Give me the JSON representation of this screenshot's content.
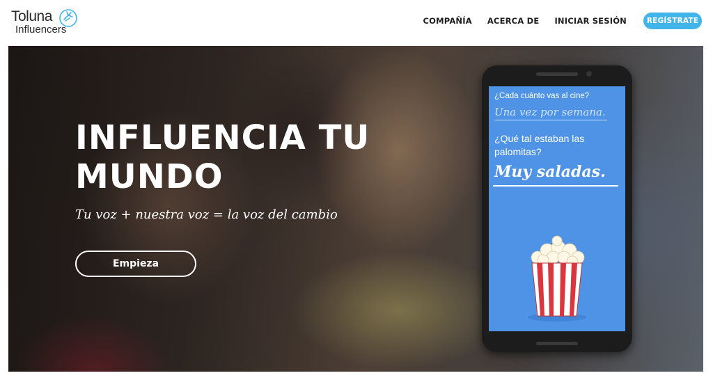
{
  "header": {
    "logo_line1": "Toluna",
    "logo_line2": "Influencers",
    "nav": [
      "COMPAÑÍA",
      "ACERCA DE",
      "INICIAR SESIÓN"
    ],
    "register_label": "REGÍSTRATE"
  },
  "hero": {
    "title_line1": "INFLUENCIA TU",
    "title_line2": "MUNDO",
    "subtitle": "Tu voz + nuestra voz = la voz del cambio",
    "cta_label": "Empieza"
  },
  "phone": {
    "question1": "¿Cada cuánto vas al cine?",
    "answer1": "Una vez por semana.",
    "question2": "¿Qué tal estaban las palomitas?",
    "answer2": "Muy saladas.",
    "screen_color": "#4f93e6"
  },
  "colors": {
    "accent": "#41b4ea"
  },
  "icons": {
    "logo_mark": "leaf-burst-icon",
    "popcorn": "popcorn-bucket-icon"
  }
}
